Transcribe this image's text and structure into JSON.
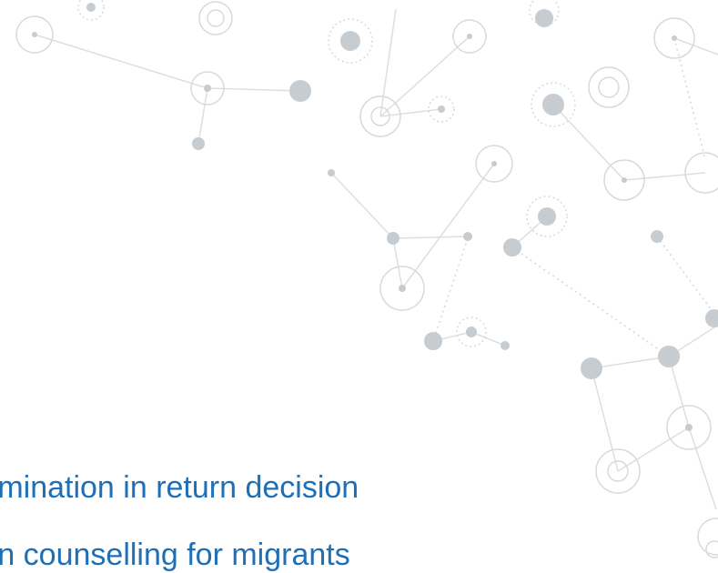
{
  "slide": {
    "bullets": [
      "rmination in return decision",
      "rn counselling for migrants"
    ]
  },
  "decoration": {
    "name": "network-graph-icon",
    "line_color": "#dcdfe2",
    "node_color": "#c7ccd1",
    "ring_color": "#d6dadd",
    "text_color": "#1f6fb6"
  }
}
